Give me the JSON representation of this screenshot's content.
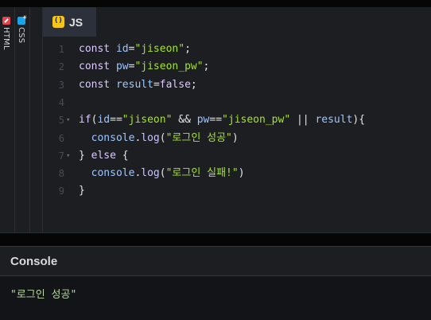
{
  "side_tabs": [
    {
      "label": "HTML",
      "icon": "html-icon",
      "color": "#e8414c"
    },
    {
      "label": "CSS",
      "icon": "css-icon",
      "color": "#19a5e8"
    }
  ],
  "editor": {
    "tab_label": "JS",
    "tab_icon": "js-icon",
    "line_numbers": [
      "1",
      "2",
      "3",
      "4",
      "5",
      "6",
      "7",
      "8",
      "9"
    ],
    "lines": [
      {
        "parts": [
          [
            "kw",
            "const "
          ],
          [
            "var",
            "id"
          ],
          [
            "plain",
            "="
          ],
          [
            "str",
            "\"jiseon\""
          ],
          [
            "plain",
            ";"
          ]
        ]
      },
      {
        "parts": [
          [
            "kw",
            "const "
          ],
          [
            "var",
            "pw"
          ],
          [
            "plain",
            "="
          ],
          [
            "str",
            "\"jiseon_pw\""
          ],
          [
            "plain",
            ";"
          ]
        ]
      },
      {
        "parts": [
          [
            "kw",
            "const "
          ],
          [
            "var",
            "result"
          ],
          [
            "plain",
            "="
          ],
          [
            "kw",
            "false"
          ],
          [
            "plain",
            ";"
          ]
        ]
      },
      {
        "parts": []
      },
      {
        "parts": [
          [
            "kw",
            "if"
          ],
          [
            "plain",
            "("
          ],
          [
            "var",
            "id"
          ],
          [
            "plain",
            "=="
          ],
          [
            "str",
            "\"jiseon\""
          ],
          [
            "plain",
            " && "
          ],
          [
            "var",
            "pw"
          ],
          [
            "plain",
            "=="
          ],
          [
            "str",
            "\"jiseon_pw\""
          ],
          [
            "plain",
            " || "
          ],
          [
            "var",
            "result"
          ],
          [
            "plain",
            "){"
          ]
        ]
      },
      {
        "parts": [
          [
            "plain",
            "  "
          ],
          [
            "var",
            "console"
          ],
          [
            "plain",
            "."
          ],
          [
            "fn",
            "log"
          ],
          [
            "plain",
            "("
          ],
          [
            "str",
            "\"로그인 성공\""
          ],
          [
            "plain",
            ")"
          ]
        ]
      },
      {
        "parts": [
          [
            "plain",
            "} "
          ],
          [
            "kw",
            "else"
          ],
          [
            "plain",
            " {"
          ]
        ]
      },
      {
        "parts": [
          [
            "plain",
            "  "
          ],
          [
            "var",
            "console"
          ],
          [
            "plain",
            "."
          ],
          [
            "fn",
            "log"
          ],
          [
            "plain",
            "("
          ],
          [
            "str",
            "\"로그인 실패!\""
          ],
          [
            "plain",
            ")"
          ]
        ]
      },
      {
        "parts": [
          [
            "plain",
            "}"
          ]
        ]
      }
    ],
    "fold_lines": [
      "5",
      "7"
    ]
  },
  "console": {
    "title": "Console",
    "output": "\"로그인 성공\""
  },
  "colors": {
    "background": "#1d1e22",
    "keyword": "#ddcaff",
    "string": "#a6e22e",
    "identifier": "#9ec7ff",
    "tab_active": "#2c303a",
    "js_badge": "#f5c518"
  }
}
